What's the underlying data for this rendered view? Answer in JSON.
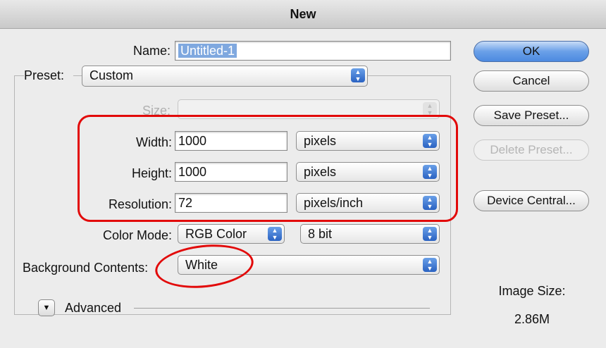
{
  "window": {
    "title": "New"
  },
  "name": {
    "label": "Name:",
    "value": "Untitled-1"
  },
  "preset": {
    "label": "Preset:",
    "value": "Custom"
  },
  "size": {
    "label": "Size:",
    "value": ""
  },
  "width": {
    "label": "Width:",
    "value": "1000",
    "unit": "pixels"
  },
  "height": {
    "label": "Height:",
    "value": "1000",
    "unit": "pixels"
  },
  "resolution": {
    "label": "Resolution:",
    "value": "72",
    "unit": "pixels/inch"
  },
  "color_mode": {
    "label": "Color Mode:",
    "mode": "RGB Color",
    "depth": "8 bit"
  },
  "background": {
    "label": "Background Contents:",
    "value": "White"
  },
  "advanced": {
    "label": "Advanced"
  },
  "buttons": {
    "ok": "OK",
    "cancel": "Cancel",
    "save_preset": "Save Preset...",
    "delete_preset": "Delete Preset...",
    "device_central": "Device Central..."
  },
  "image_size": {
    "label": "Image Size:",
    "value": "2.86M"
  },
  "icons": {
    "popup_arrow": "updown-arrow-icon",
    "disclosure": "disclosure-triangle-icon"
  },
  "colors": {
    "annotation": "#e20a0a",
    "accent": "#4d8ae0"
  }
}
